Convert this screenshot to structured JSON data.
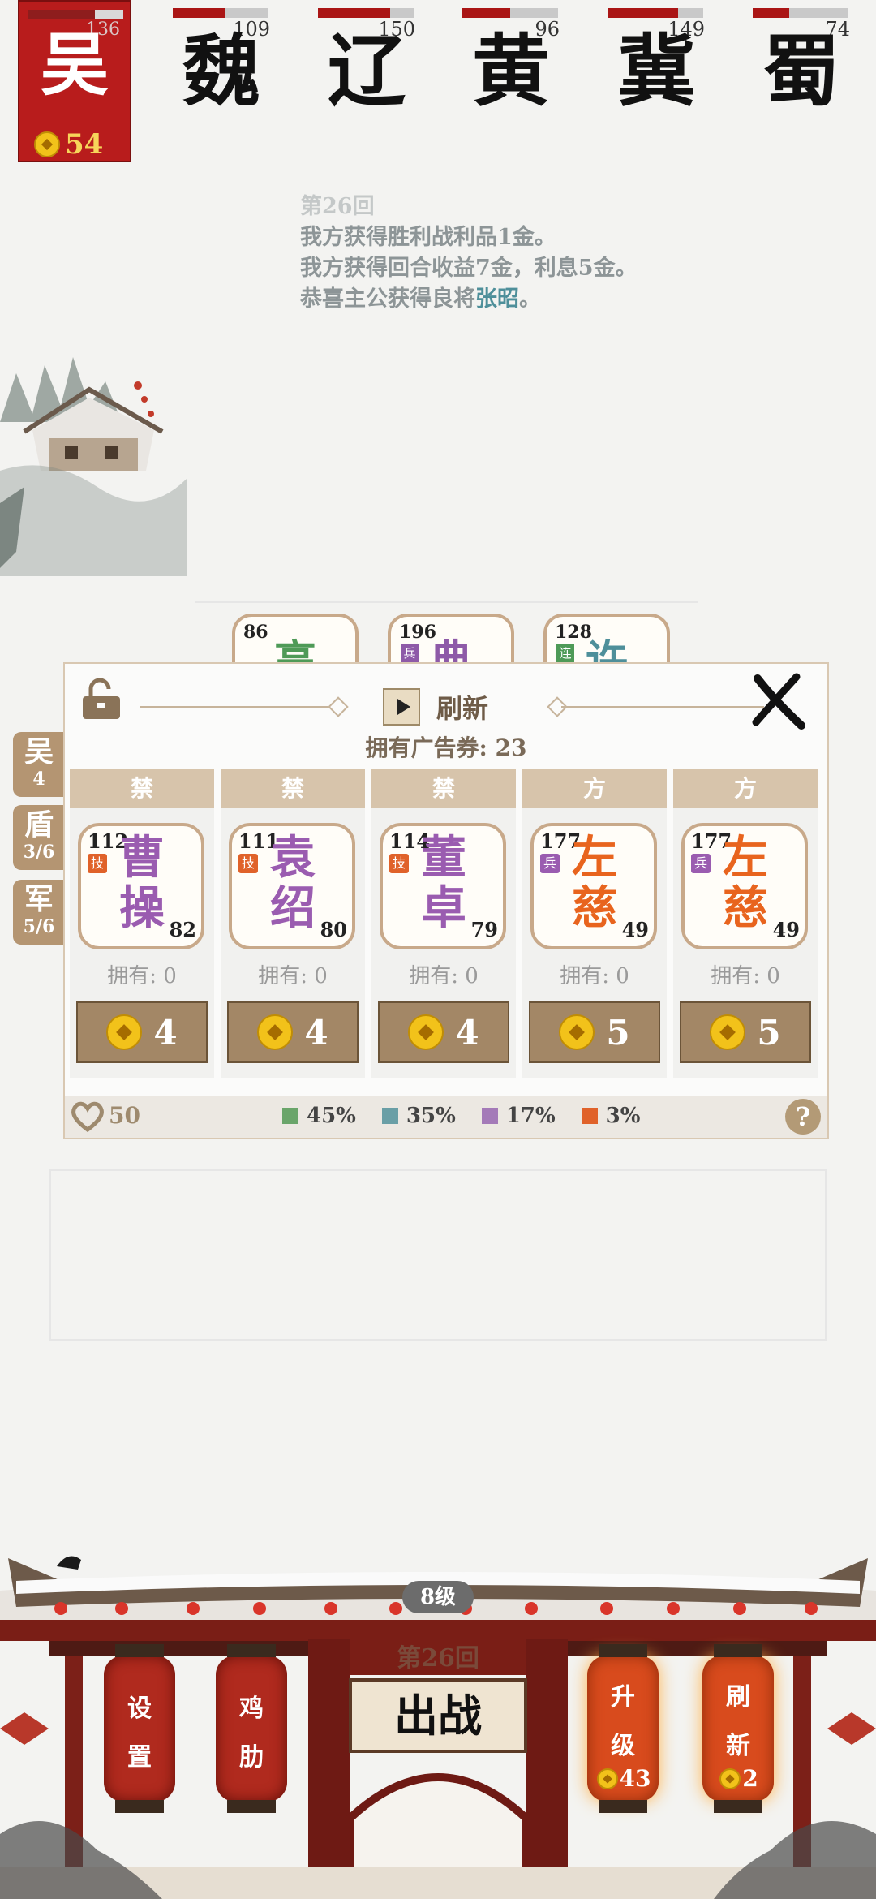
{
  "player": {
    "faction": "吴",
    "hp": "136",
    "gold": "54"
  },
  "enemies": [
    {
      "name": "魏",
      "hp": "109",
      "hp_fill": 0.55
    },
    {
      "name": "辽",
      "hp": "150",
      "hp_fill": 0.75
    },
    {
      "name": "黄",
      "hp": "96",
      "hp_fill": 0.5
    },
    {
      "name": "冀",
      "hp": "149",
      "hp_fill": 0.74
    },
    {
      "name": "蜀",
      "hp": "74",
      "hp_fill": 0.38
    }
  ],
  "log": {
    "line0": "第26回",
    "line1": "我方获得胜利战利品1金。",
    "line2": "我方获得回合收益7金，利息5金。",
    "line3_prefix": "恭喜主公获得良将",
    "line3_name": "张昭",
    "line3_suffix": "。"
  },
  "board_cards": [
    {
      "num": "86",
      "name": "高",
      "tag": "",
      "color": "#4e9a57"
    },
    {
      "num": "196",
      "name": "典",
      "tag": "兵",
      "color": "#8e5aa8"
    },
    {
      "num": "128",
      "name": "许",
      "tag": "连",
      "color": "#4e8f9a"
    }
  ],
  "side_tabs": [
    {
      "title": "吴",
      "sub": "4"
    },
    {
      "title": "盾",
      "sub": "3/6"
    },
    {
      "title": "军",
      "sub": "5/6"
    }
  ],
  "shop": {
    "refresh_label": "刷新",
    "coupons_label": "拥有广告券: 23",
    "slots": [
      {
        "header": "禁",
        "num": "112",
        "tag": "技",
        "tag_color": "#e0622a",
        "name1": "曹",
        "name2": "操",
        "name_color": "#9a5cb0",
        "level": "82",
        "own": "拥有: 0",
        "price": "4"
      },
      {
        "header": "禁",
        "num": "111",
        "tag": "技",
        "tag_color": "#e0622a",
        "name1": "袁",
        "name2": "绍",
        "name_color": "#9a5cb0",
        "level": "80",
        "own": "拥有: 0",
        "price": "4"
      },
      {
        "header": "禁",
        "num": "114",
        "tag": "技",
        "tag_color": "#e0622a",
        "name1": "董",
        "name2": "卓",
        "name_color": "#9a5cb0",
        "level": "79",
        "own": "拥有: 0",
        "price": "4"
      },
      {
        "header": "方",
        "num": "177",
        "tag": "兵",
        "tag_color": "#9a5cb0",
        "name1": "左",
        "name2": "慈",
        "name_color": "#e8641e",
        "level": "49",
        "own": "拥有: 0",
        "price": "5"
      },
      {
        "header": "方",
        "num": "177",
        "tag": "兵",
        "tag_color": "#9a5cb0",
        "name1": "左",
        "name2": "慈",
        "name_color": "#e8641e",
        "level": "49",
        "own": "拥有: 0",
        "price": "5"
      }
    ],
    "hearts": "50",
    "odds": [
      {
        "label": "45%",
        "color": "#6aa56a"
      },
      {
        "label": "35%",
        "color": "#6a9fa6"
      },
      {
        "label": "17%",
        "color": "#a47ab8"
      },
      {
        "label": "3%",
        "color": "#e0622a"
      }
    ],
    "help": "?"
  },
  "bottom": {
    "level": "8级",
    "round": "第26回",
    "battle": "出战",
    "settings": "设置",
    "rib": "鸡肋",
    "upgrade": "升级",
    "upgrade_cost": "43",
    "refresh": "刷新",
    "refresh_cost": "2"
  }
}
